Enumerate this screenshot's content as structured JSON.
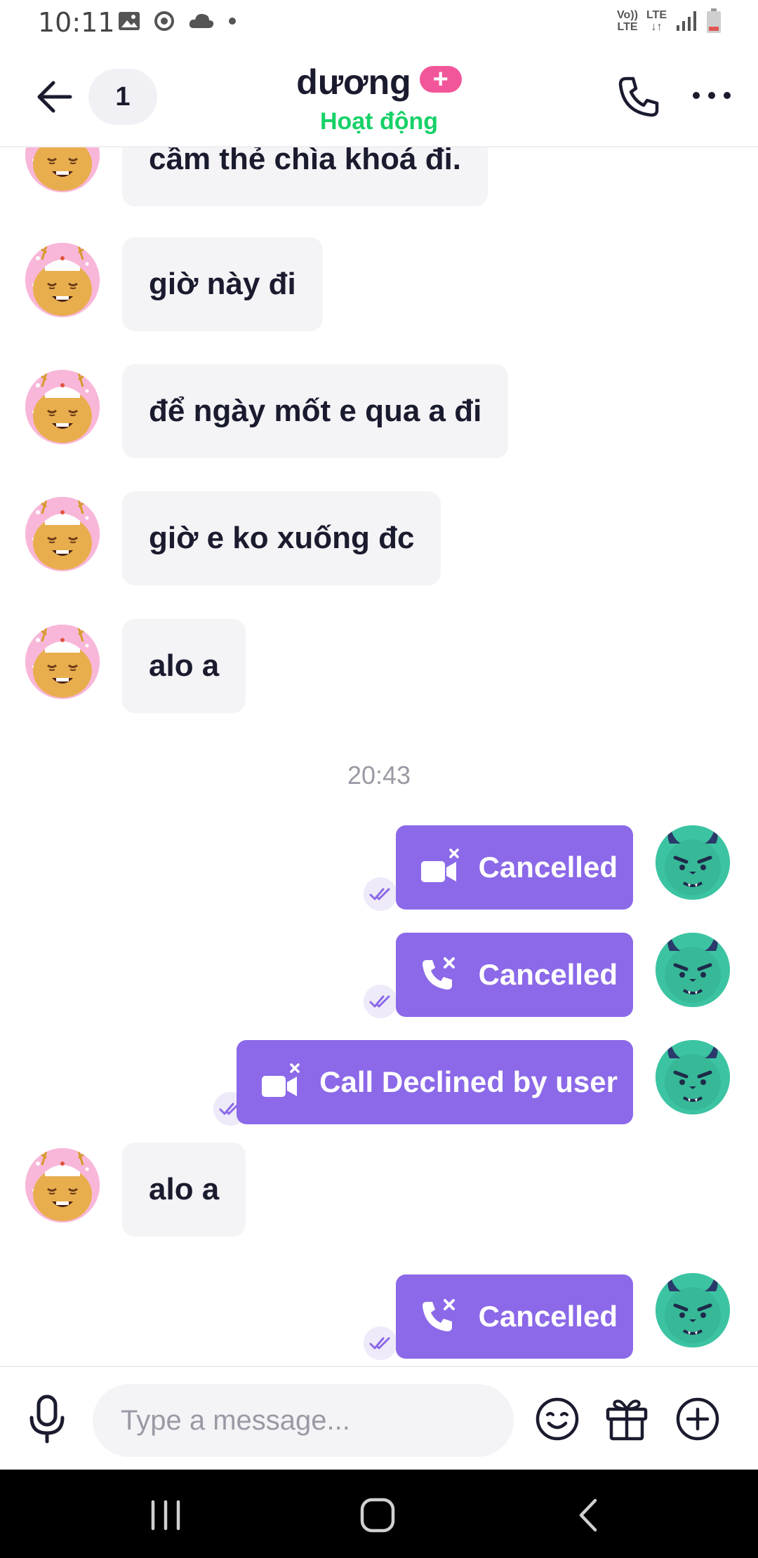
{
  "status_bar": {
    "time": "10:11",
    "network_top": "Vo))",
    "network_bottom": "LTE",
    "lte": "LTE"
  },
  "header": {
    "unread_count": "1",
    "contact_name": "dương",
    "plus_symbol": "+",
    "presence": "Hoạt động"
  },
  "messages": {
    "incoming_1": "cầm thẻ chìa khoá đi.",
    "incoming_2": "giờ này đi",
    "incoming_3": "để ngày mốt e qua a đi",
    "incoming_4": "giờ e ko xuống đc",
    "incoming_5": "alo a",
    "time_divider": "20:43",
    "outgoing_1": "Cancelled",
    "outgoing_2": "Cancelled",
    "outgoing_3": "Call Declined by user",
    "incoming_6": "alo a",
    "outgoing_4": "Cancelled"
  },
  "composer": {
    "placeholder": "Type a message..."
  },
  "colors": {
    "accent_purple": "#8b69e8",
    "presence_green": "#17d168",
    "badge_pink": "#f2569a",
    "incoming_bubble": "#f4f4f7"
  },
  "icons": {
    "back": "arrow-left-icon",
    "call": "phone-icon",
    "more": "more-horizontal-icon",
    "video_missed": "video-cancel-icon",
    "phone_missed": "phone-cancel-icon",
    "read_receipt": "double-check-icon",
    "mic": "microphone-icon",
    "emoji": "smile-icon",
    "gift": "gift-icon",
    "add": "plus-circle-icon"
  }
}
